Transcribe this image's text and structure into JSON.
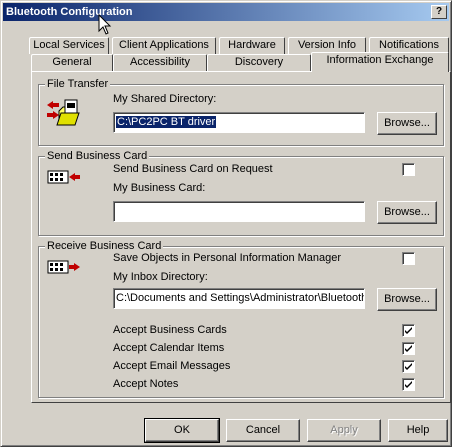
{
  "window": {
    "title": "Bluetooth Configuration",
    "help_label": "?"
  },
  "tabs": {
    "row1": [
      "Local Services",
      "Client Applications",
      "Hardware",
      "Version Info",
      "Notifications"
    ],
    "row2": [
      "General",
      "Accessibility",
      "Discovery",
      "Information Exchange"
    ],
    "active": "Information Exchange"
  },
  "file_transfer": {
    "group_title": "File Transfer",
    "dir_label": "My Shared Directory:",
    "dir_value": "C:\\PC2PC BT driver",
    "browse_label": "Browse..."
  },
  "send_card": {
    "group_title": "Send Business Card",
    "on_request_label": "Send Business Card on Request",
    "on_request_checked": false,
    "card_label": "My Business Card:",
    "card_value": "",
    "browse_label": "Browse..."
  },
  "receive_card": {
    "group_title": "Receive Business Card",
    "save_pim_label": "Save Objects in Personal Information Manager",
    "save_pim_checked": false,
    "inbox_label": "My Inbox Directory:",
    "inbox_value": "C:\\Documents and Settings\\Administrator\\Bluetooth",
    "browse_label": "Browse...",
    "accept": [
      {
        "label": "Accept Business Cards",
        "checked": true
      },
      {
        "label": "Accept Calendar Items",
        "checked": true
      },
      {
        "label": "Accept Email Messages",
        "checked": true
      },
      {
        "label": "Accept Notes",
        "checked": true
      }
    ]
  },
  "footer": {
    "ok_label": "OK",
    "cancel_label": "Cancel",
    "apply_label": "Apply",
    "help_label": "Help"
  }
}
